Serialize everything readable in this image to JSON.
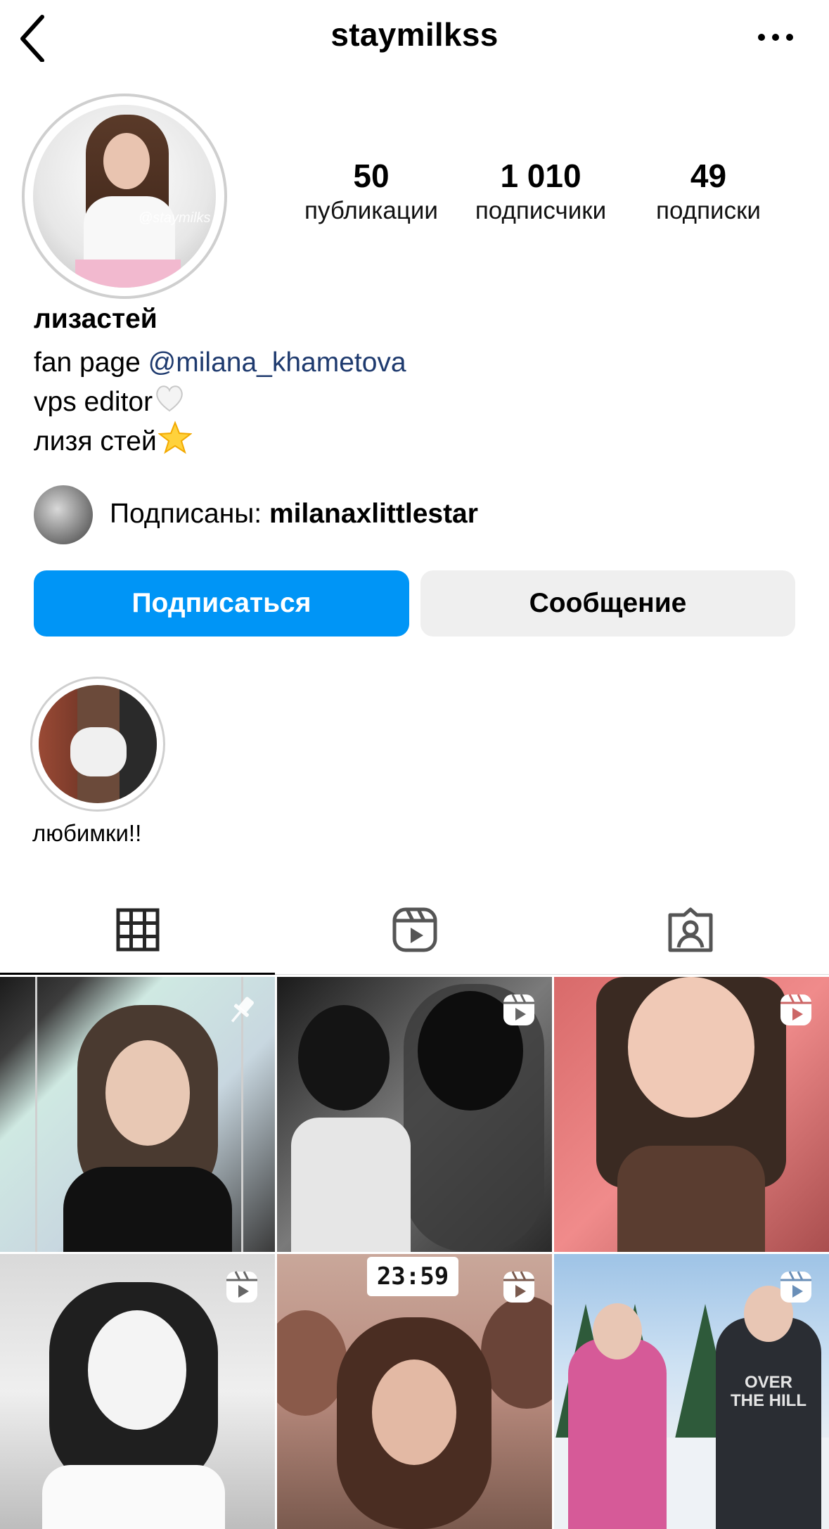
{
  "header": {
    "username": "staymilkss"
  },
  "profile": {
    "avatar_watermark": "@staymilks",
    "stats": [
      {
        "value": "50",
        "label": "публикации"
      },
      {
        "value": "1 010",
        "label": "подписчики"
      },
      {
        "value": "49",
        "label": "подписки"
      }
    ],
    "display_name": "лизастей",
    "bio": {
      "line1_prefix": "fan page ",
      "line1_mention": "@milana_khametova",
      "line2": "vps editor",
      "line3": "лизя стей"
    },
    "followed_by": {
      "prefix": "Подписаны: ",
      "username": "milanaxlittlestar"
    }
  },
  "actions": {
    "follow_label": "Подписаться",
    "message_label": "Сообщение"
  },
  "highlights": [
    {
      "label": "любимки!!"
    }
  ],
  "tabs": [
    {
      "icon": "grid-icon",
      "active": true
    },
    {
      "icon": "reels-icon",
      "active": false
    },
    {
      "icon": "tagged-icon",
      "active": false
    }
  ],
  "posts": [
    {
      "badge": "pin-icon"
    },
    {
      "badge": "reels-icon"
    },
    {
      "badge": "reels-icon"
    },
    {
      "badge": "reels-icon"
    },
    {
      "badge": "reels-icon",
      "overlay_text": "23:59"
    },
    {
      "badge": "reels-icon",
      "overlay_text": "OVER THE HILL"
    }
  ]
}
